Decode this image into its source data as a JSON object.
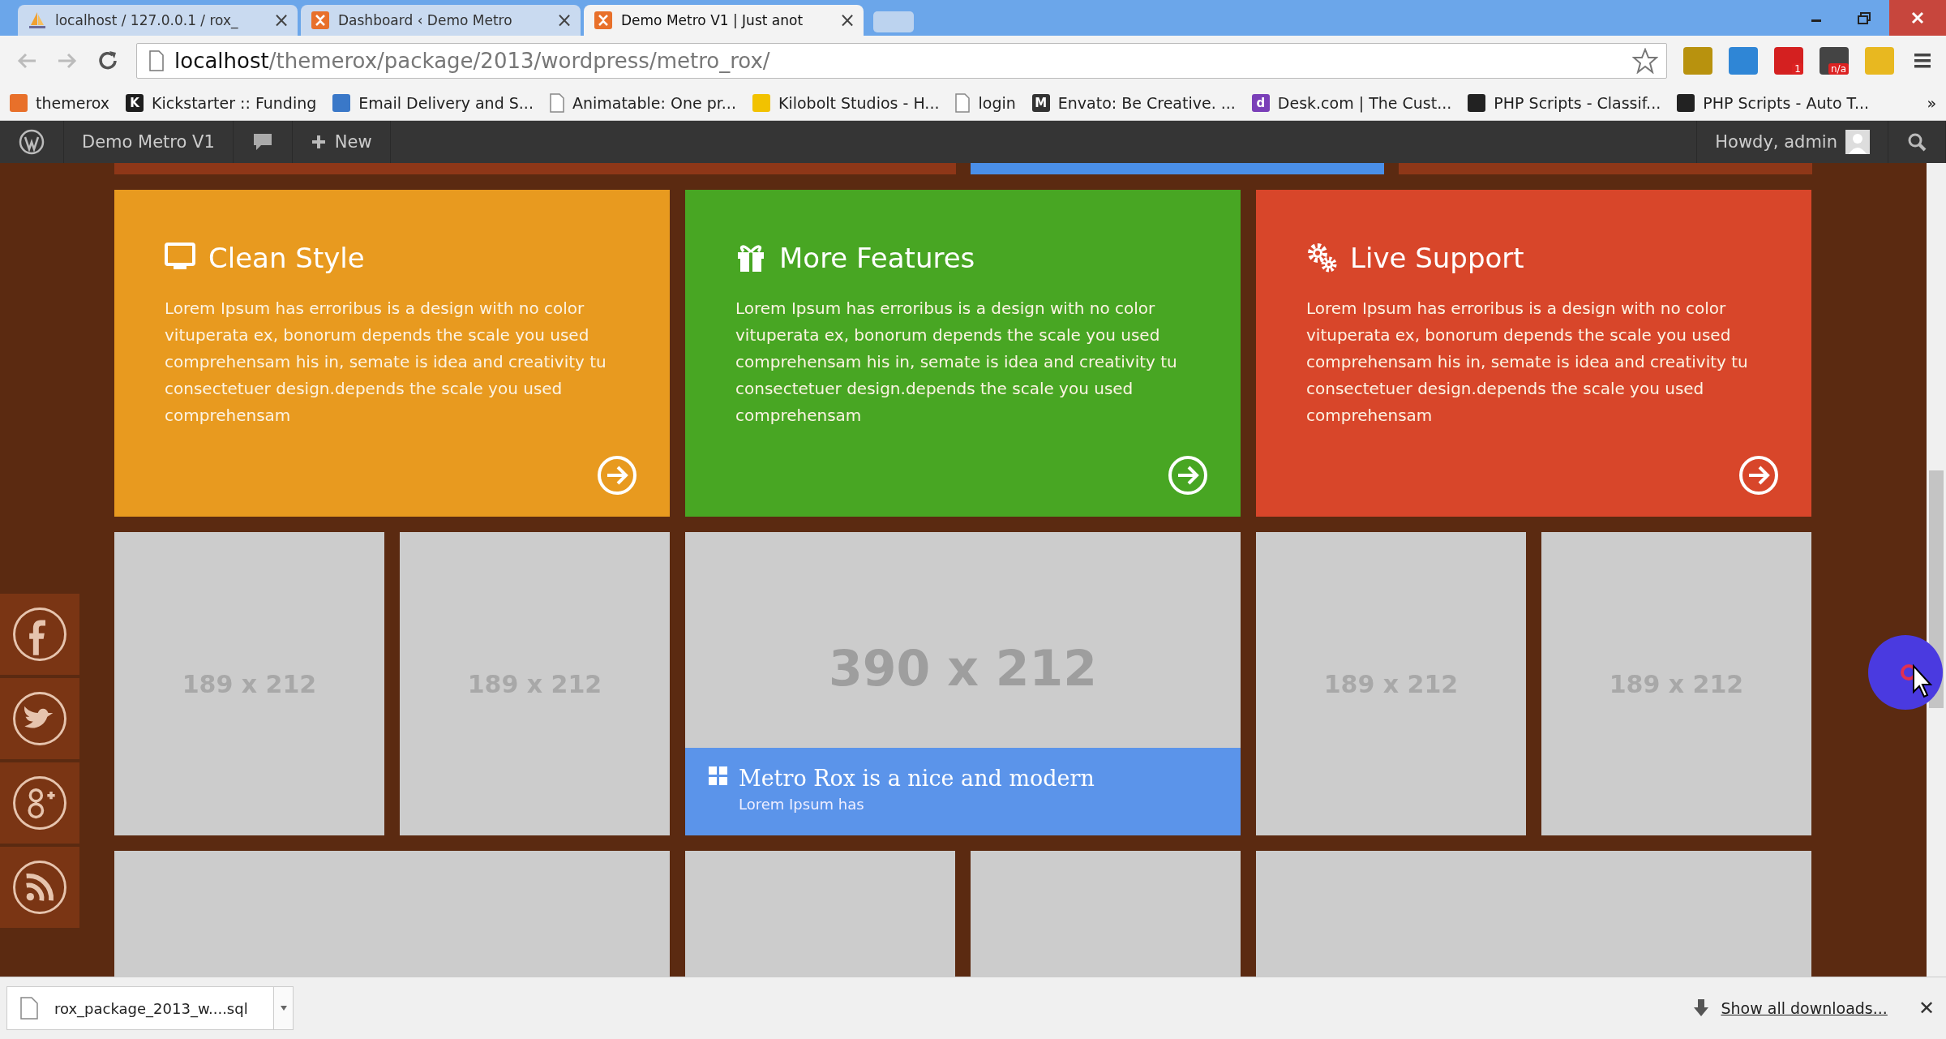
{
  "browser": {
    "tabs": [
      {
        "title": "localhost / 127.0.0.1 / rox_",
        "kind": "pma",
        "close": "×",
        "selected": false
      },
      {
        "title": "Dashboard ‹ Demo Metro",
        "kind": "xampp",
        "close": "×",
        "selected": false
      },
      {
        "title": "Demo Metro V1 | Just anot",
        "kind": "xampp",
        "close": "×",
        "selected": true
      }
    ],
    "address": {
      "host": "localhost",
      "path": "/themerox/package/2013/wordpress/metro_rox/"
    },
    "extensions": [
      {
        "color": "#b8920e"
      },
      {
        "color": "#2f86d6"
      },
      {
        "color": "#d42020",
        "badge": "1"
      },
      {
        "color": "#444444",
        "badge": "n/a"
      },
      {
        "color": "#e8b820"
      }
    ],
    "bookmarks": [
      {
        "label": "themerox",
        "kind": "favicon",
        "color": "#e8702a"
      },
      {
        "label": "Kickstarter :: Funding",
        "kind": "favicon",
        "color": "#1d1d1d",
        "glyph": "K"
      },
      {
        "label": "Email Delivery and S...",
        "kind": "favicon",
        "color": "#3a78c8"
      },
      {
        "label": "Animatable: One pr...",
        "kind": "page"
      },
      {
        "label": "Kilobolt Studios - H...",
        "kind": "favicon",
        "color": "#f2c200"
      },
      {
        "label": "login",
        "kind": "page"
      },
      {
        "label": "Envato: Be Creative. ...",
        "kind": "favicon",
        "color": "#333333",
        "glyph": "M"
      },
      {
        "label": "Desk.com | The Cust...",
        "kind": "favicon",
        "color": "#7a3fb8",
        "glyph": "d"
      },
      {
        "label": "PHP Scripts - Classif...",
        "kind": "favicon",
        "color": "#222222"
      },
      {
        "label": "PHP Scripts - Auto T...",
        "kind": "favicon",
        "color": "#222222"
      }
    ],
    "more_bookmarks": "»"
  },
  "admin_bar": {
    "site_title": "Demo Metro V1",
    "new_label": "New",
    "greeting": "Howdy, admin"
  },
  "feature_cards": [
    {
      "title": "Clean Style",
      "kind": "monitor",
      "color": "#e89a1f",
      "text": "Lorem Ipsum has erroribus is a design with no color vituperata ex, bonorum depends the scale you used comprehensam his in, semate is idea and creativity tu consectetuer design.depends the scale you used comprehensam"
    },
    {
      "title": "More Features",
      "kind": "gift",
      "color": "#48a623",
      "text": "Lorem Ipsum has erroribus is a design with no color vituperata ex, bonorum depends the scale you used comprehensam his in, semate is idea and creativity tu consectetuer design.depends the scale you used comprehensam"
    },
    {
      "title": "Live Support",
      "kind": "gears",
      "color": "#d8462a",
      "text": "Lorem Ipsum has erroribus is a design with no color vituperata ex, bonorum depends the scale you used comprehensam his in, semate is idea and creativity tu consectetuer design.depends the scale you used comprehensam"
    }
  ],
  "tiles": [
    {
      "label": "189 x 212",
      "kind": "small"
    },
    {
      "label": "189 x 212",
      "kind": "small"
    },
    {
      "label": "390 x 212",
      "kind": "large",
      "caption": {
        "title": "Metro Rox is a nice and modern",
        "subtitle": "Lorem Ipsum has"
      }
    },
    {
      "label": "189 x 212",
      "kind": "small"
    },
    {
      "label": "189 x 212",
      "kind": "small"
    }
  ],
  "social": [
    {
      "kind": "facebook"
    },
    {
      "kind": "twitter"
    },
    {
      "kind": "googleplus"
    },
    {
      "kind": "rss"
    }
  ],
  "download_bar": {
    "file": "rox_package_2013_w....sql",
    "show_all": "Show all downloads...",
    "close": "✕"
  }
}
